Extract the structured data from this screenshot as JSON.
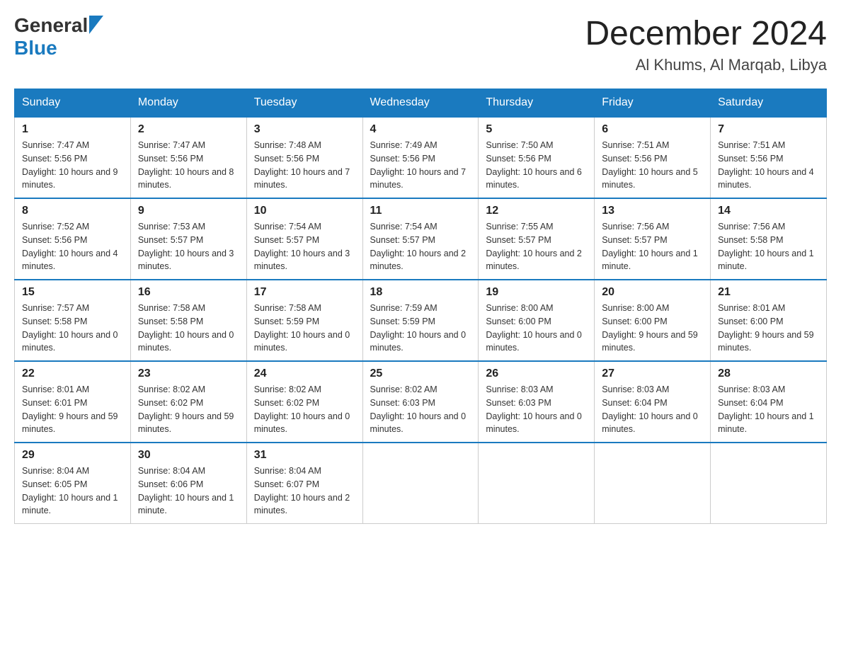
{
  "header": {
    "logo_general": "General",
    "logo_blue": "Blue",
    "month_year": "December 2024",
    "location": "Al Khums, Al Marqab, Libya"
  },
  "weekdays": [
    "Sunday",
    "Monday",
    "Tuesday",
    "Wednesday",
    "Thursday",
    "Friday",
    "Saturday"
  ],
  "weeks": [
    [
      {
        "day": "1",
        "sunrise": "7:47 AM",
        "sunset": "5:56 PM",
        "daylight": "10 hours and 9 minutes."
      },
      {
        "day": "2",
        "sunrise": "7:47 AM",
        "sunset": "5:56 PM",
        "daylight": "10 hours and 8 minutes."
      },
      {
        "day": "3",
        "sunrise": "7:48 AM",
        "sunset": "5:56 PM",
        "daylight": "10 hours and 7 minutes."
      },
      {
        "day": "4",
        "sunrise": "7:49 AM",
        "sunset": "5:56 PM",
        "daylight": "10 hours and 7 minutes."
      },
      {
        "day": "5",
        "sunrise": "7:50 AM",
        "sunset": "5:56 PM",
        "daylight": "10 hours and 6 minutes."
      },
      {
        "day": "6",
        "sunrise": "7:51 AM",
        "sunset": "5:56 PM",
        "daylight": "10 hours and 5 minutes."
      },
      {
        "day": "7",
        "sunrise": "7:51 AM",
        "sunset": "5:56 PM",
        "daylight": "10 hours and 4 minutes."
      }
    ],
    [
      {
        "day": "8",
        "sunrise": "7:52 AM",
        "sunset": "5:56 PM",
        "daylight": "10 hours and 4 minutes."
      },
      {
        "day": "9",
        "sunrise": "7:53 AM",
        "sunset": "5:57 PM",
        "daylight": "10 hours and 3 minutes."
      },
      {
        "day": "10",
        "sunrise": "7:54 AM",
        "sunset": "5:57 PM",
        "daylight": "10 hours and 3 minutes."
      },
      {
        "day": "11",
        "sunrise": "7:54 AM",
        "sunset": "5:57 PM",
        "daylight": "10 hours and 2 minutes."
      },
      {
        "day": "12",
        "sunrise": "7:55 AM",
        "sunset": "5:57 PM",
        "daylight": "10 hours and 2 minutes."
      },
      {
        "day": "13",
        "sunrise": "7:56 AM",
        "sunset": "5:57 PM",
        "daylight": "10 hours and 1 minute."
      },
      {
        "day": "14",
        "sunrise": "7:56 AM",
        "sunset": "5:58 PM",
        "daylight": "10 hours and 1 minute."
      }
    ],
    [
      {
        "day": "15",
        "sunrise": "7:57 AM",
        "sunset": "5:58 PM",
        "daylight": "10 hours and 0 minutes."
      },
      {
        "day": "16",
        "sunrise": "7:58 AM",
        "sunset": "5:58 PM",
        "daylight": "10 hours and 0 minutes."
      },
      {
        "day": "17",
        "sunrise": "7:58 AM",
        "sunset": "5:59 PM",
        "daylight": "10 hours and 0 minutes."
      },
      {
        "day": "18",
        "sunrise": "7:59 AM",
        "sunset": "5:59 PM",
        "daylight": "10 hours and 0 minutes."
      },
      {
        "day": "19",
        "sunrise": "8:00 AM",
        "sunset": "6:00 PM",
        "daylight": "10 hours and 0 minutes."
      },
      {
        "day": "20",
        "sunrise": "8:00 AM",
        "sunset": "6:00 PM",
        "daylight": "9 hours and 59 minutes."
      },
      {
        "day": "21",
        "sunrise": "8:01 AM",
        "sunset": "6:00 PM",
        "daylight": "9 hours and 59 minutes."
      }
    ],
    [
      {
        "day": "22",
        "sunrise": "8:01 AM",
        "sunset": "6:01 PM",
        "daylight": "9 hours and 59 minutes."
      },
      {
        "day": "23",
        "sunrise": "8:02 AM",
        "sunset": "6:02 PM",
        "daylight": "9 hours and 59 minutes."
      },
      {
        "day": "24",
        "sunrise": "8:02 AM",
        "sunset": "6:02 PM",
        "daylight": "10 hours and 0 minutes."
      },
      {
        "day": "25",
        "sunrise": "8:02 AM",
        "sunset": "6:03 PM",
        "daylight": "10 hours and 0 minutes."
      },
      {
        "day": "26",
        "sunrise": "8:03 AM",
        "sunset": "6:03 PM",
        "daylight": "10 hours and 0 minutes."
      },
      {
        "day": "27",
        "sunrise": "8:03 AM",
        "sunset": "6:04 PM",
        "daylight": "10 hours and 0 minutes."
      },
      {
        "day": "28",
        "sunrise": "8:03 AM",
        "sunset": "6:04 PM",
        "daylight": "10 hours and 1 minute."
      }
    ],
    [
      {
        "day": "29",
        "sunrise": "8:04 AM",
        "sunset": "6:05 PM",
        "daylight": "10 hours and 1 minute."
      },
      {
        "day": "30",
        "sunrise": "8:04 AM",
        "sunset": "6:06 PM",
        "daylight": "10 hours and 1 minute."
      },
      {
        "day": "31",
        "sunrise": "8:04 AM",
        "sunset": "6:07 PM",
        "daylight": "10 hours and 2 minutes."
      },
      null,
      null,
      null,
      null
    ]
  ]
}
